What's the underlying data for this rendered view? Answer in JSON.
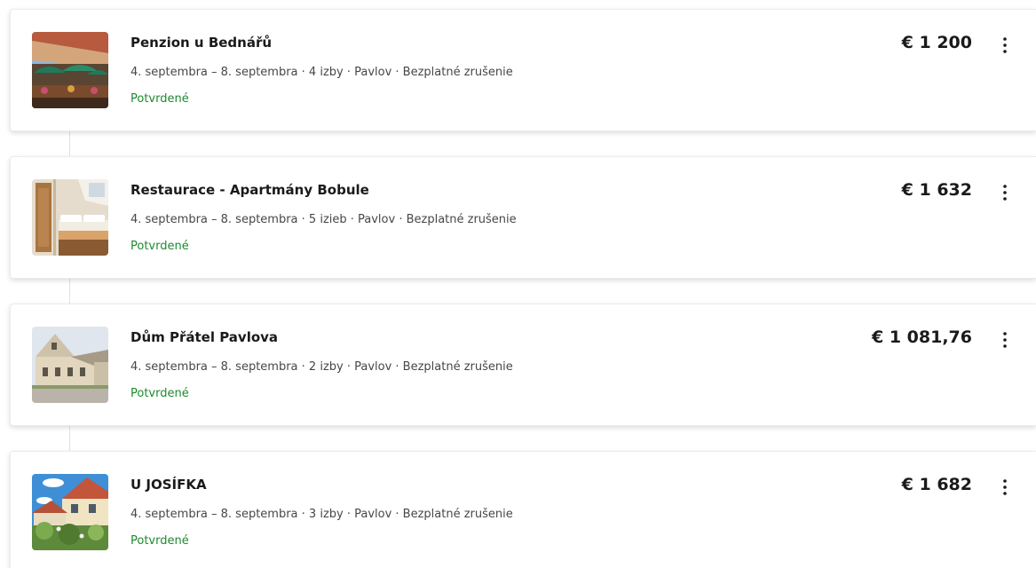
{
  "bookings": [
    {
      "image": "guesthouse-terrace-photo",
      "title": "Penzion u Bednářů",
      "details": "4. septembra – 8. septembra · 4 izby · Pavlov · Bezplatné zrušenie",
      "status": "Potvrdené",
      "price": "€ 1 200",
      "menu_icon": "more-vertical-icon"
    },
    {
      "image": "apartment-bedroom-photo",
      "title": "Restaurace - Apartmány Bobule",
      "details": "4. septembra – 8. septembra · 5 izieb · Pavlov · Bezplatné zrušenie",
      "status": "Potvrdené",
      "price": "€ 1 632",
      "menu_icon": "more-vertical-icon"
    },
    {
      "image": "house-exterior-photo",
      "title": "Dům Přátel Pavlova",
      "details": "4. septembra – 8. septembra · 2 izby · Pavlov · Bezplatné zrušenie",
      "status": "Potvrdené",
      "price": "€ 1 081,76",
      "menu_icon": "more-vertical-icon"
    },
    {
      "image": "village-house-garden-photo",
      "title": "U JOSÍFKA",
      "details": "4. septembra – 8. septembra · 3 izby · Pavlov · Bezplatné zrušenie",
      "status": "Potvrdené",
      "price": "€ 1 682",
      "menu_icon": "more-vertical-icon"
    }
  ],
  "colors": {
    "status_confirmed": "#1e8a2e",
    "title_text": "#1a1a1a",
    "detail_text": "#474747"
  }
}
